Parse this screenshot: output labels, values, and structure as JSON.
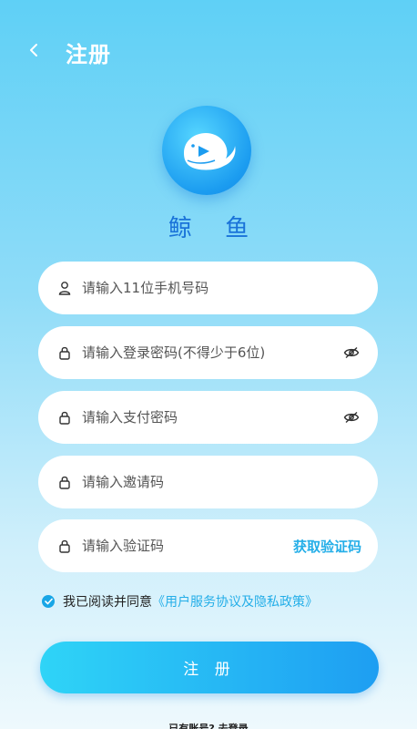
{
  "header": {
    "title": "注册",
    "back_icon": "chevron-left-icon"
  },
  "logo": {
    "icon": "whale-logo-icon",
    "app_name": "鲸 鱼"
  },
  "form": {
    "phone": {
      "placeholder": "请输入11位手机号码",
      "icon": "user-icon"
    },
    "login_password": {
      "placeholder": "请输入登录密码(不得少于6位)",
      "icon": "lock-icon",
      "toggle_icon": "eye-off-icon"
    },
    "pay_password": {
      "placeholder": "请输入支付密码",
      "icon": "lock-icon",
      "toggle_icon": "eye-off-icon"
    },
    "invite_code": {
      "placeholder": "请输入邀请码",
      "icon": "lock-icon"
    },
    "verify_code": {
      "placeholder": "请输入验证码",
      "icon": "lock-icon",
      "get_code_label": "获取验证码"
    }
  },
  "agreement": {
    "checked": true,
    "text": "我已阅读并同意",
    "link": "《用户服务协议及隐私政策》"
  },
  "submit_label": "注 册",
  "footer_text": "已有账号? 去登录",
  "colors": {
    "accent": "#24aee8",
    "brand_text": "#1a73d9",
    "button_start": "#2fd4f7",
    "button_end": "#1e9ef2"
  }
}
